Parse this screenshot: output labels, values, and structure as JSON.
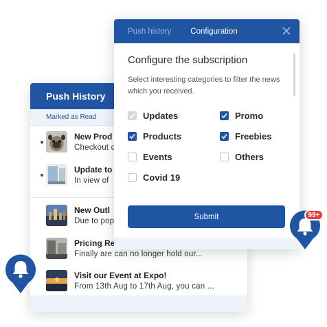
{
  "history": {
    "title": "Push History",
    "subheader": "Marked as Read",
    "items": [
      {
        "title": "New Prod",
        "body": "Checkout c",
        "unread": true
      },
      {
        "title": "Update to",
        "body": "In view of",
        "unread": true
      },
      {
        "title": "New Outl",
        "body": "Due to pop",
        "unread": false
      },
      {
        "title": "Pricing Re",
        "body": "Finally are can no longer hold our...",
        "unread": false
      },
      {
        "title": "Visit our Event at Expo!",
        "body": "From 13th Aug to 17th Aug, you can ...",
        "unread": false
      }
    ]
  },
  "config": {
    "tabs": [
      "Push history",
      "Configuration"
    ],
    "active_tab": "Configuration",
    "title": "Configure the subscription",
    "description": "Select interesting categories to filter the news which you received.",
    "options": [
      {
        "label": "Updates",
        "state": "disabled-checked"
      },
      {
        "label": "Promo",
        "state": "checked"
      },
      {
        "label": "Products",
        "state": "checked"
      },
      {
        "label": "Freebies",
        "state": "checked"
      },
      {
        "label": "Events",
        "state": "unchecked"
      },
      {
        "label": "Others",
        "state": "unchecked"
      },
      {
        "label": "Covid 19",
        "state": "unchecked"
      }
    ],
    "submit_label": "Submit"
  },
  "badge": {
    "count": "99+"
  },
  "colors": {
    "brand": "#1f55a3",
    "badge": "#e83b3b",
    "muted": "#eef3fa"
  }
}
